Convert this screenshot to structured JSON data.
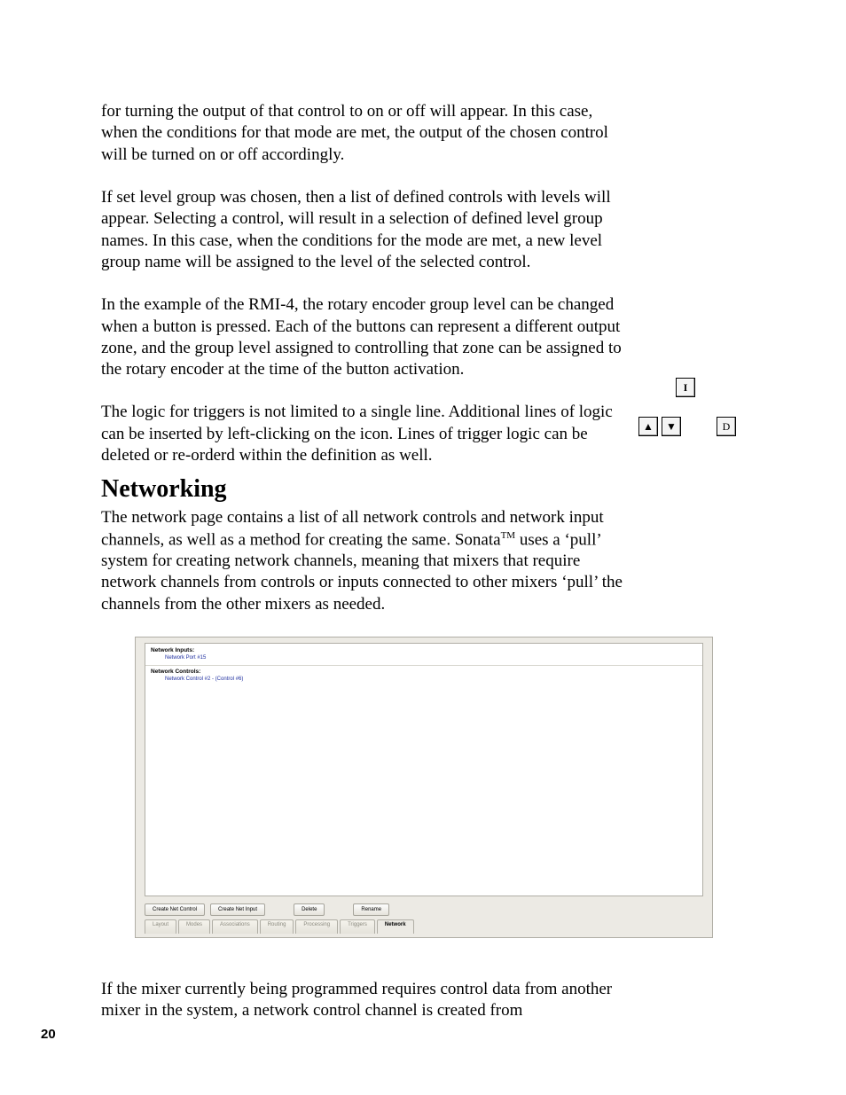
{
  "paragraphs": {
    "p1": "for turning the output of that control to on or off will appear.  In this case, when the conditions for that mode are met, the output of the chosen control will be turned on or off accordingly.",
    "p2": "If set level group was chosen, then a list of defined controls with levels will appear.  Selecting a control, will result in a selection of defined level group names.  In this case, when the conditions for the mode are met, a new level group name will be assigned to the level of the selected control.",
    "p3": "In the example of the RMI-4, the rotary encoder group level can be changed when a button is pressed.  Each of the buttons can represent a different output zone, and the group level assigned to controlling that zone can be assigned to the rotary encoder at the time of the button activation.",
    "p4": "The logic for triggers is not limited to a single line.  Additional lines of logic can be inserted by left-clicking on the  icon.  Lines of trigger logic can be deleted  or re-orderd  within the definition as well."
  },
  "heading": "Networking",
  "networking_intro_a": "The network page contains a list of all network controls and network input channels, as well as a method for creating the same.  Sonata",
  "networking_intro_b": " uses a ‘pull’ system for creating network channels, meaning that mixers that require network channels from controls or inputs connected to other mixers ‘pull’ the channels from the other mixers as needed.",
  "bottom_para": "If the mixer currently being programmed requires control data from another mixer in the system, a network control channel is created from",
  "app": {
    "inputs_label": "Network Inputs:",
    "inputs_item": "Network Port #15",
    "controls_label": "Network Controls:",
    "controls_item": "Network Control #2  -  (Control #6)",
    "buttons": {
      "create_control": "Create Net Control",
      "create_input": "Create Net Input",
      "delete": "Delete",
      "rename": "Rename"
    },
    "tabs": {
      "layout": "Layout",
      "modes": "Modes",
      "associations": "Associations",
      "routing": "Routing",
      "processing": "Processing",
      "triggers": "Triggers",
      "network": "Network"
    }
  },
  "icons": {
    "insert": "I",
    "up": "▲",
    "down": "▼",
    "delete": "D"
  },
  "page_number": "20"
}
